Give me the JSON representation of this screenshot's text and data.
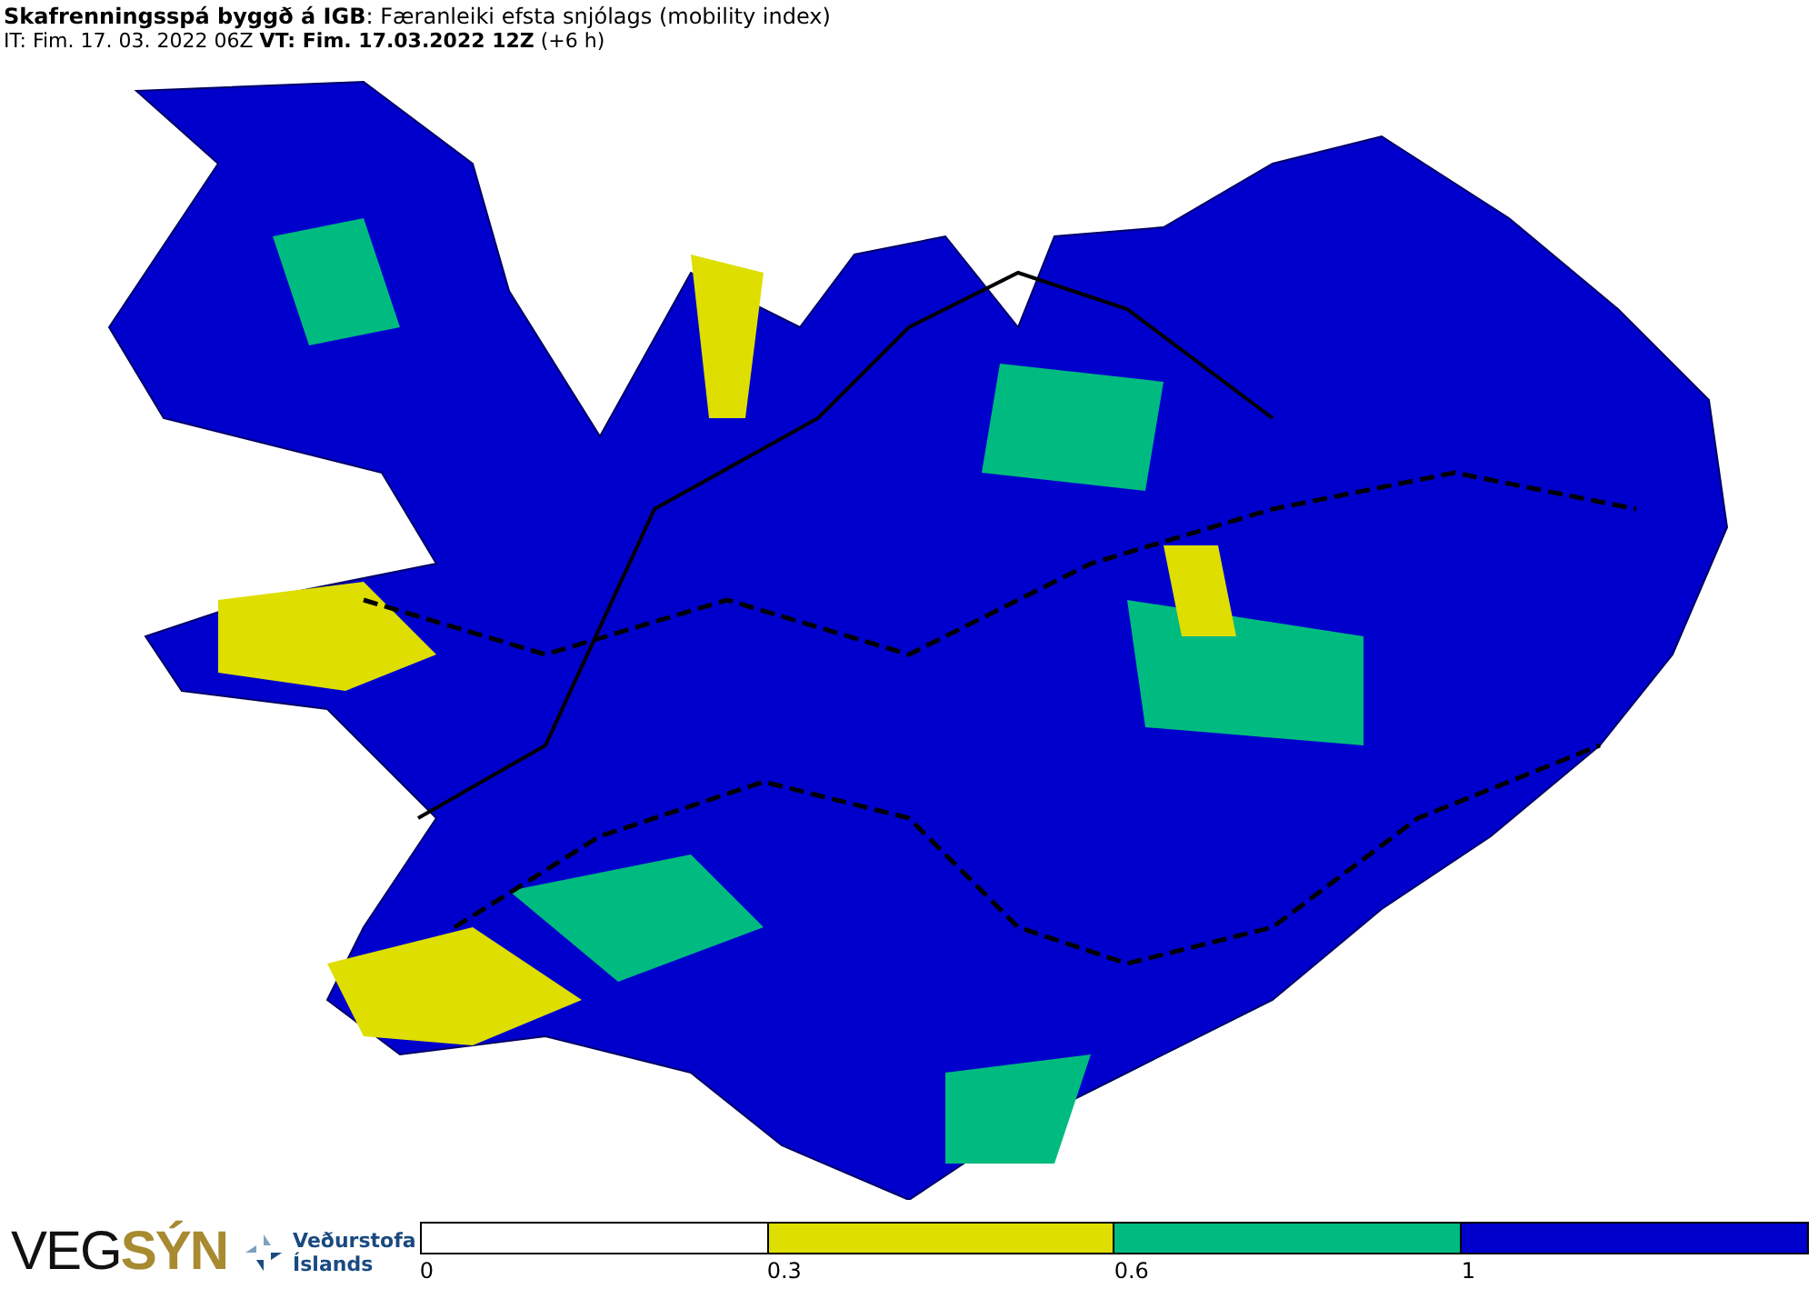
{
  "header": {
    "title_bold": "Skafrenningsspá byggð á IGB",
    "title_rest": ": Færanleiki efsta snjólags (mobility index)",
    "it_label": "IT: Fim. 17. 03. 2022 06Z",
    "vt_label": "VT: Fim. 17.03.2022 12Z",
    "vt_offset": "(+6 h)"
  },
  "logos": {
    "vegsyn_a": "VEG",
    "vegsyn_b": "SÝN",
    "vedur_line1": "Veðurstofa",
    "vedur_line2": "Íslands"
  },
  "legend": {
    "segments": [
      {
        "color": "#ffffff"
      },
      {
        "color": "#dede00"
      },
      {
        "color": "#00bb80"
      },
      {
        "color": "#0000cc"
      }
    ],
    "ticks": [
      "0",
      "0.3",
      "0.6",
      "1"
    ]
  }
}
